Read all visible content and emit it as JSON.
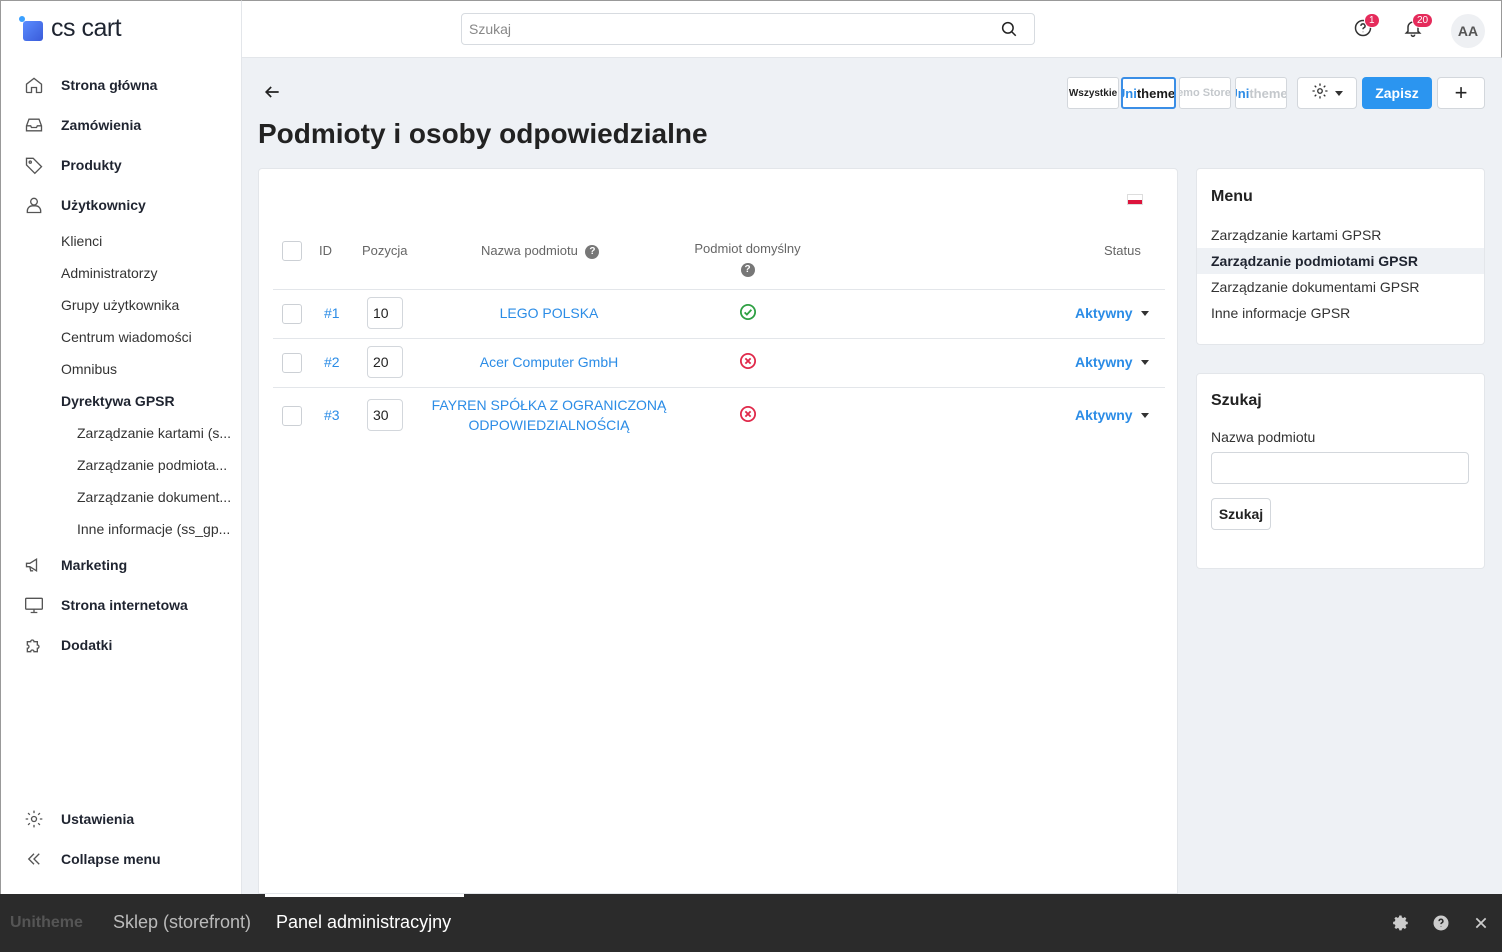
{
  "app": {
    "logo_text": "cs cart"
  },
  "sidebar": {
    "items": [
      {
        "label": "Strona główna",
        "icon": "home-icon"
      },
      {
        "label": "Zamówienia",
        "icon": "inbox-icon"
      },
      {
        "label": "Produkty",
        "icon": "tag-icon"
      },
      {
        "label": "Użytkownicy",
        "icon": "user-icon"
      }
    ],
    "users_sub": [
      "Klienci",
      "Administratorzy",
      "Grupy użytkownika",
      "Centrum wiadomości",
      "Omnibus",
      "Dyrektywa GPSR"
    ],
    "gpsr_sub": [
      "Zarządzanie kartami (s...",
      "Zarządzanie podmiota...",
      "Zarządzanie dokument...",
      "Inne informacje (ss_gp..."
    ],
    "items2": [
      {
        "label": "Marketing",
        "icon": "megaphone-icon"
      },
      {
        "label": "Strona internetowa",
        "icon": "monitor-icon"
      },
      {
        "label": "Dodatki",
        "icon": "puzzle-icon"
      }
    ],
    "settings_label": "Ustawienia",
    "collapse_label": "Collapse menu"
  },
  "topbar": {
    "search_placeholder": "Szukaj",
    "help_badge": "1",
    "notif_badge": "20",
    "avatar": "AA"
  },
  "toolbar": {
    "stores": [
      "Wszystkie",
      "Unitheme",
      "Demo Store",
      "Unitheme"
    ],
    "save_label": "Zapisz",
    "plus_label": "+"
  },
  "page": {
    "title": "Podmioty i osoby odpowiedzialne"
  },
  "table": {
    "headers": {
      "id": "ID",
      "position": "Pozycja",
      "name": "Nazwa podmiotu",
      "default": "Podmiot domyślny",
      "status": "Status"
    },
    "rows": [
      {
        "id": "#1",
        "position": "10",
        "name": "LEGO POLSKA",
        "default": true,
        "status": "Aktywny"
      },
      {
        "id": "#2",
        "position": "20",
        "name": "Acer Computer GmbH",
        "default": false,
        "status": "Aktywny"
      },
      {
        "id": "#3",
        "position": "30",
        "name": "FAYREN SPÓŁKA Z OGRANICZONĄ ODPOWIEDZIALNOŚCIĄ",
        "default": false,
        "status": "Aktywny"
      }
    ]
  },
  "menu_panel": {
    "title": "Menu",
    "items": [
      "Zarządzanie kartami GPSR",
      "Zarządzanie podmiotami GPSR",
      "Zarządzanie dokumentami GPSR",
      "Inne informacje GPSR"
    ]
  },
  "search_panel": {
    "title": "Szukaj",
    "field_label": "Nazwa podmiotu",
    "button": "Szukaj"
  },
  "bottombar": {
    "logo": "Unitheme",
    "tabs": [
      "Sklep (storefront)",
      "Panel administracyjny"
    ]
  },
  "colors": {
    "accent": "#2b95f0",
    "link": "#2b8ce6",
    "ok": "#2ea043",
    "err": "#e0294a"
  }
}
